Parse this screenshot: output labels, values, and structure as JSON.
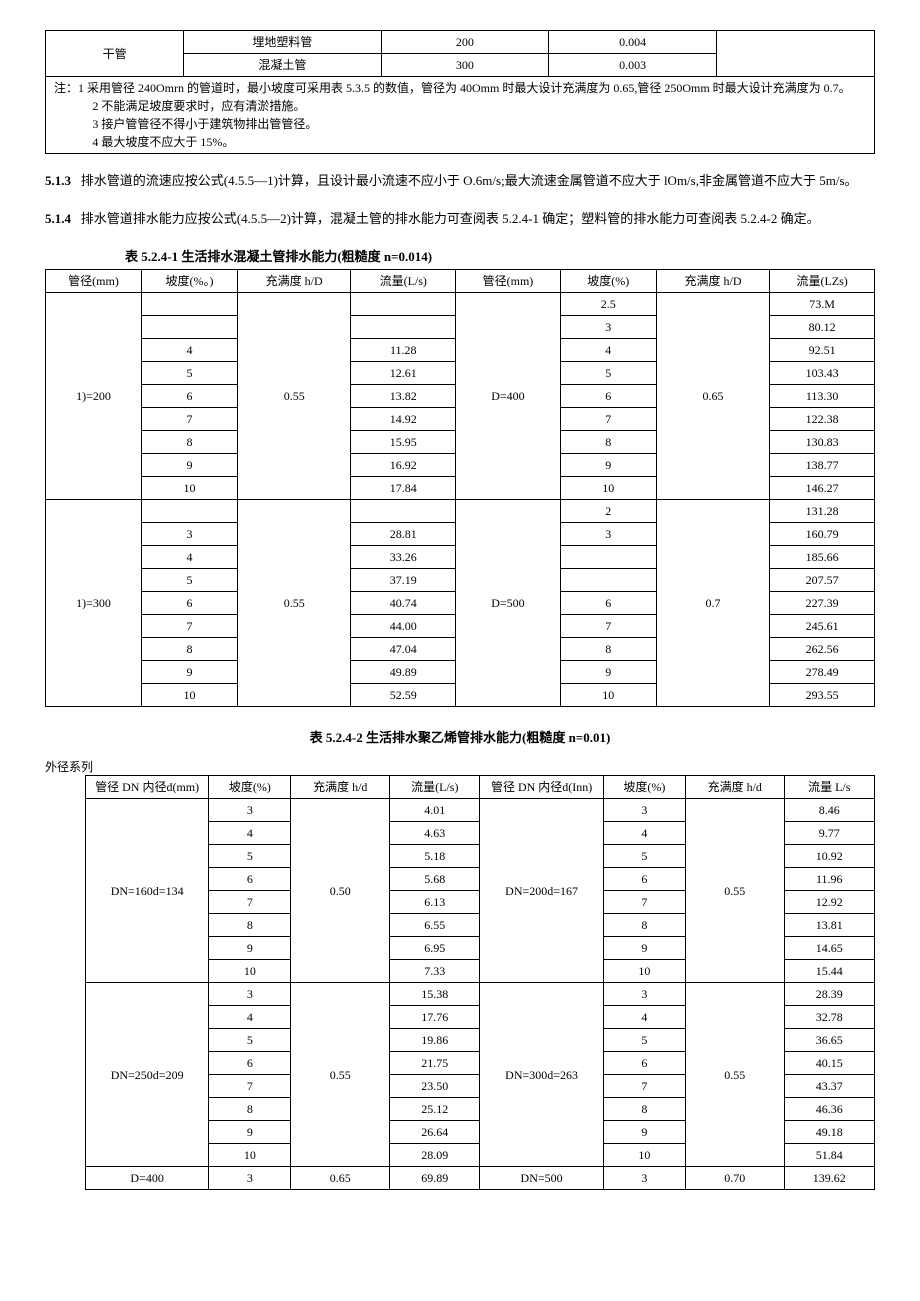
{
  "top_table": {
    "col1": "干管",
    "rows": [
      [
        "埋地塑料管",
        "200",
        "0.004"
      ],
      [
        "混凝土管",
        "300",
        "0.003"
      ]
    ],
    "notes": [
      "注：1 采用管径 240Omrn 的管道时，最小坡度可采用表 5.3.5 的数值，管径为 40Omm 时最大设计充满度为 0.65,管径 250Omm 时最大设计充满度为 0.7。",
      "2 不能满足坡度要求时，应有清淤措施。",
      "3 接户管管径不得小于建筑物排出管管径。",
      "4 最大坡度不应大于 15%。"
    ]
  },
  "para513": {
    "num": "5.1.3",
    "text": "排水管道的流速应按公式(4.5.5—1)计算，且设计最小流速不应小于 O.6m/s;最大流速金属管道不应大于 lOm/s,非金属管道不应大于 5m/s。"
  },
  "para514": {
    "num": "5.1.4",
    "text": "排水管道排水能力应按公式(4.5.5—2)计算，混凝土管的排水能力可查阅表 5.2.4-1 确定；塑料管的排水能力可查阅表 5.2.4-2 确定。"
  },
  "chart_data": [
    {
      "type": "table",
      "title": "表 5.2.4-1           生活排水混凝土管排水能力(粗糙度 n=0.014)",
      "headers": [
        "管径(mm)",
        "坡度(%。)",
        "充满度 h/D",
        "流量(L/s)",
        "管径(mm)",
        "坡度(%)",
        "充满度 h/D",
        "流量(LZs)"
      ],
      "groups": [
        {
          "leftD": "1)=200",
          "leftH": "0.55",
          "rightD": "D=400",
          "rightH": "0.65",
          "rows": [
            [
              "",
              "",
              "2.5",
              "73.M"
            ],
            [
              "",
              "",
              "3",
              "80.12"
            ],
            [
              "4",
              "11.28",
              "4",
              "92.51"
            ],
            [
              "5",
              "12.61",
              "5",
              "103.43"
            ],
            [
              "6",
              "13.82",
              "6",
              "113.30"
            ],
            [
              "7",
              "14.92",
              "7",
              "122.38"
            ],
            [
              "8",
              "15.95",
              "8",
              "130.83"
            ],
            [
              "9",
              "16.92",
              "9",
              "138.77"
            ],
            [
              "10",
              "17.84",
              "10",
              "146.27"
            ]
          ]
        },
        {
          "leftD": "1)=300",
          "leftH": "0.55",
          "rightD": "D=500",
          "rightH": "0.7",
          "rows": [
            [
              "",
              "",
              "2",
              "131.28"
            ],
            [
              "3",
              "28.81",
              "3",
              "160.79"
            ],
            [
              "4",
              "33.26",
              "",
              "185.66"
            ],
            [
              "5",
              "37.19",
              "",
              "207.57"
            ],
            [
              "6",
              "40.74",
              "6",
              "227.39"
            ],
            [
              "7",
              "44.00",
              "7",
              "245.61"
            ],
            [
              "8",
              "47.04",
              "8",
              "262.56"
            ],
            [
              "9",
              "49.89",
              "9",
              "278.49"
            ],
            [
              "10",
              "52.59",
              "10",
              "293.55"
            ]
          ]
        }
      ]
    },
    {
      "type": "table",
      "title": "表 5.2.4-2           生活排水聚乙烯管排水能力(粗糙度 n=0.01)",
      "side_label": "外径系列",
      "headers": [
        "管径 DN 内径d(mm)",
        "坡度(%)",
        "充满度 h/d",
        "流量(L/s)",
        "管径 DN 内径d(Inn)",
        "坡度(%)",
        "充满度 h/d",
        "流量 L/s"
      ],
      "groups": [
        {
          "leftD": "DN=160d=134",
          "leftH": "0.50",
          "rightD": "DN=200d=167",
          "rightH": "0.55",
          "rows": [
            [
              "3",
              "4.01",
              "3",
              "8.46"
            ],
            [
              "4",
              "4.63",
              "4",
              "9.77"
            ],
            [
              "5",
              "5.18",
              "5",
              "10.92"
            ],
            [
              "6",
              "5.68",
              "6",
              "11.96"
            ],
            [
              "7",
              "6.13",
              "7",
              "12.92"
            ],
            [
              "8",
              "6.55",
              "8",
              "13.81"
            ],
            [
              "9",
              "6.95",
              "9",
              "14.65"
            ],
            [
              "10",
              "7.33",
              "10",
              "15.44"
            ]
          ]
        },
        {
          "leftD": "DN=250d=209",
          "leftH": "0.55",
          "rightD": "DN=300d=263",
          "rightH": "0.55",
          "rows": [
            [
              "3",
              "15.38",
              "3",
              "28.39"
            ],
            [
              "4",
              "17.76",
              "4",
              "32.78"
            ],
            [
              "5",
              "19.86",
              "5",
              "36.65"
            ],
            [
              "6",
              "21.75",
              "6",
              "40.15"
            ],
            [
              "7",
              "23.50",
              "7",
              "43.37"
            ],
            [
              "8",
              "25.12",
              "8",
              "46.36"
            ],
            [
              "9",
              "26.64",
              "9",
              "49.18"
            ],
            [
              "10",
              "28.09",
              "10",
              "51.84"
            ]
          ]
        }
      ],
      "last_row": [
        "D=400",
        "3",
        "0.65",
        "69.89",
        "DN=500",
        "3",
        "0.70",
        "139.62"
      ]
    }
  ]
}
